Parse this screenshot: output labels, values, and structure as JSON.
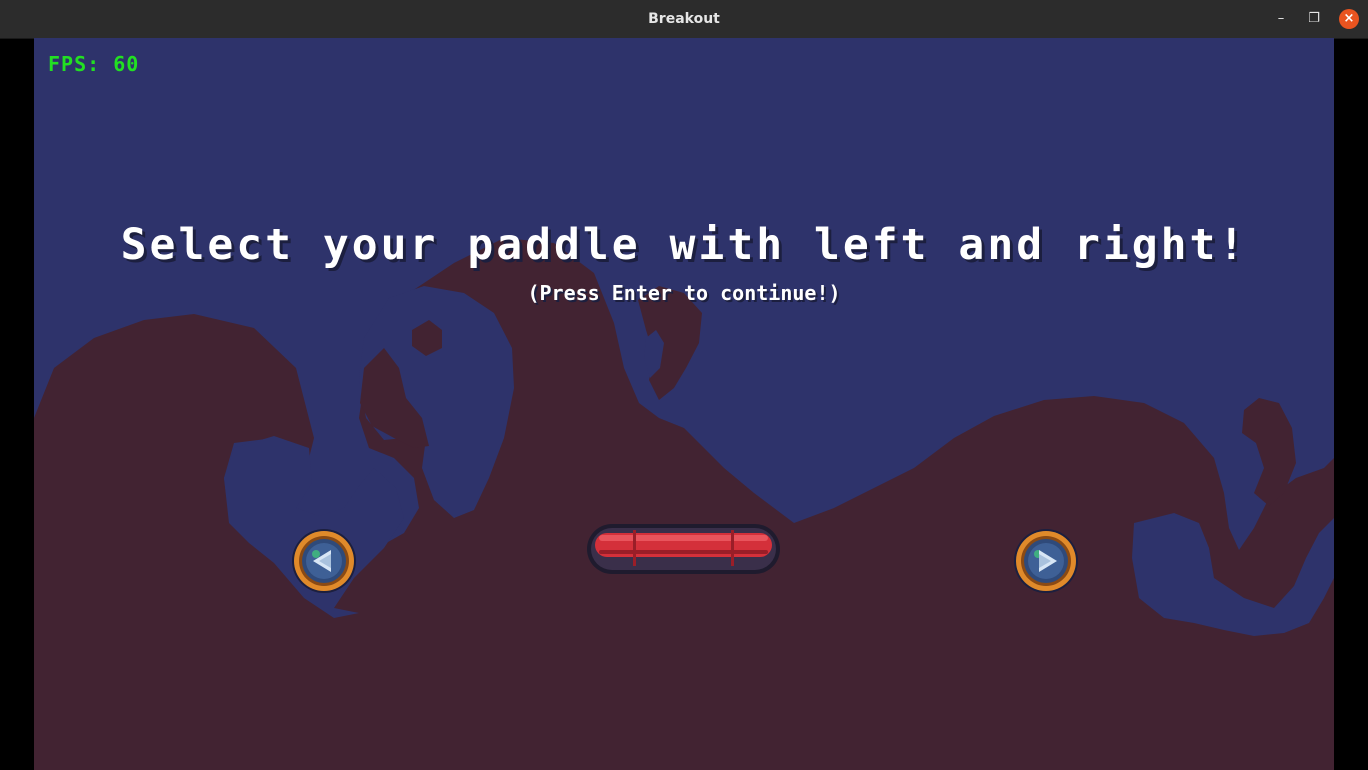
{
  "window": {
    "title": "Breakout"
  },
  "hud": {
    "fps_label": "FPS: 60"
  },
  "menu": {
    "headline": "Select your paddle with left and right!",
    "subline": "(Press Enter to continue!)"
  },
  "colors": {
    "sky": "#2e336b",
    "ground": "#422332",
    "fps_text": "#22e022",
    "paddle_red": "#d4303a",
    "button_ring": "#e08a2a"
  },
  "icons": {
    "left": "left-arrow-icon",
    "right": "right-arrow-icon",
    "minimize": "minimize-icon",
    "maximize": "maximize-icon",
    "close": "close-icon"
  }
}
